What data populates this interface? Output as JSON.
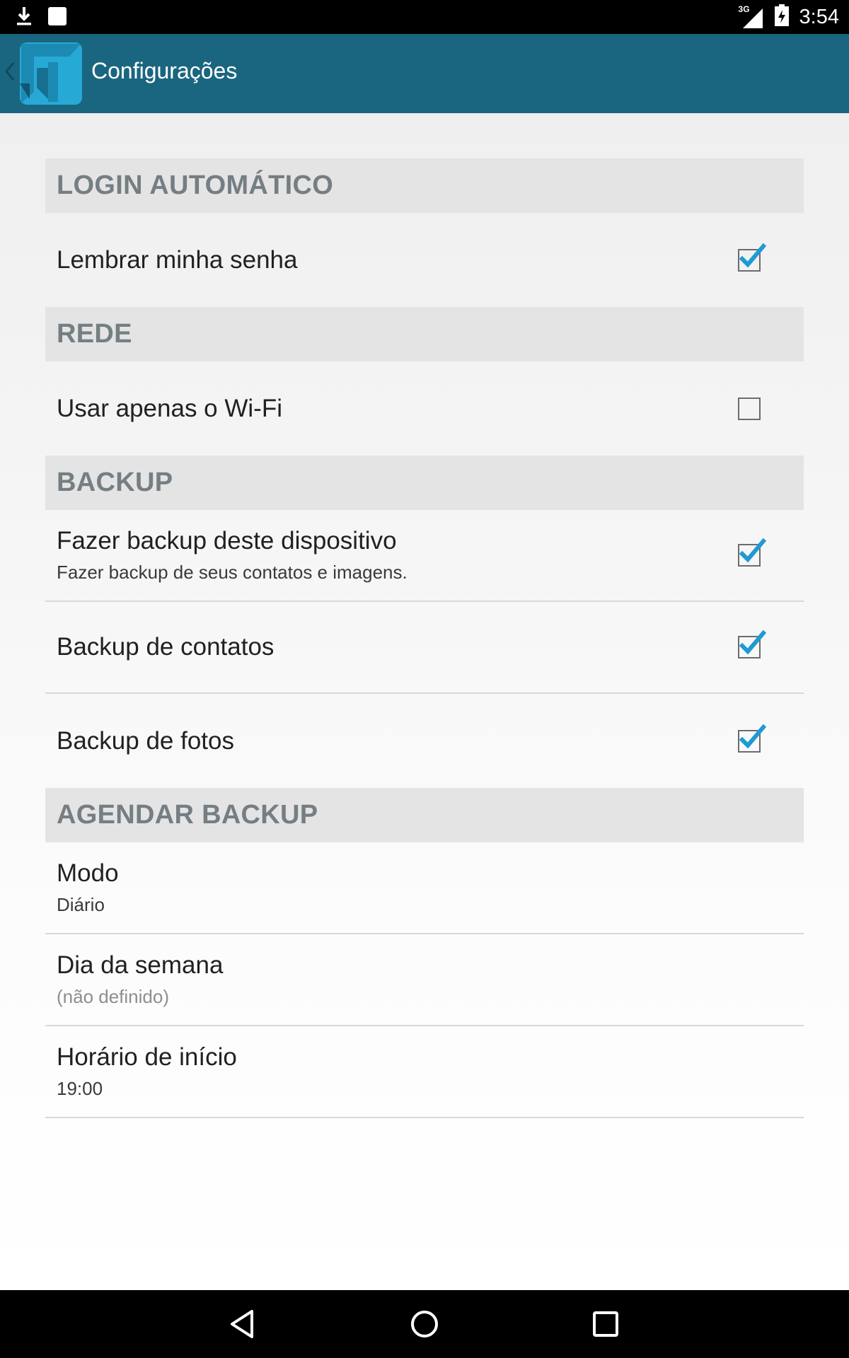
{
  "status_bar": {
    "time": "3:54",
    "network": "3G",
    "icons": [
      "download-icon",
      "notification-square-icon",
      "signal-icon",
      "battery-icon"
    ]
  },
  "app_bar": {
    "title": "Configurações",
    "icons": [
      "chevron-left-icon",
      "app-logo-icon"
    ],
    "color": "#1a6680"
  },
  "sections": [
    {
      "header": "LOGIN AUTOMÁTICO",
      "items": [
        {
          "title": "Lembrar minha senha",
          "checked": true
        }
      ]
    },
    {
      "header": "REDE",
      "items": [
        {
          "title": "Usar apenas o Wi-Fi",
          "checked": false
        }
      ]
    },
    {
      "header": "BACKUP",
      "items": [
        {
          "title": "Fazer backup deste dispositivo",
          "summary": "Fazer backup de seus contatos e imagens.",
          "checked": true
        },
        {
          "title": "Backup de contatos",
          "checked": true
        },
        {
          "title": "Backup de fotos",
          "checked": true
        }
      ]
    },
    {
      "header": "AGENDAR BACKUP",
      "items": [
        {
          "title": "Modo",
          "summary": "Diário"
        },
        {
          "title": "Dia da semana",
          "summary": "(não definido)"
        },
        {
          "title": "Horário de início",
          "summary": "19:00"
        }
      ]
    }
  ],
  "nav_bar": {
    "icons": [
      "back-triangle-icon",
      "home-circle-icon",
      "recents-square-icon"
    ]
  },
  "colors": {
    "accent": "#1e9bd1",
    "section_header_text": "#757e83",
    "section_header_bg": "#e4e4e4"
  }
}
